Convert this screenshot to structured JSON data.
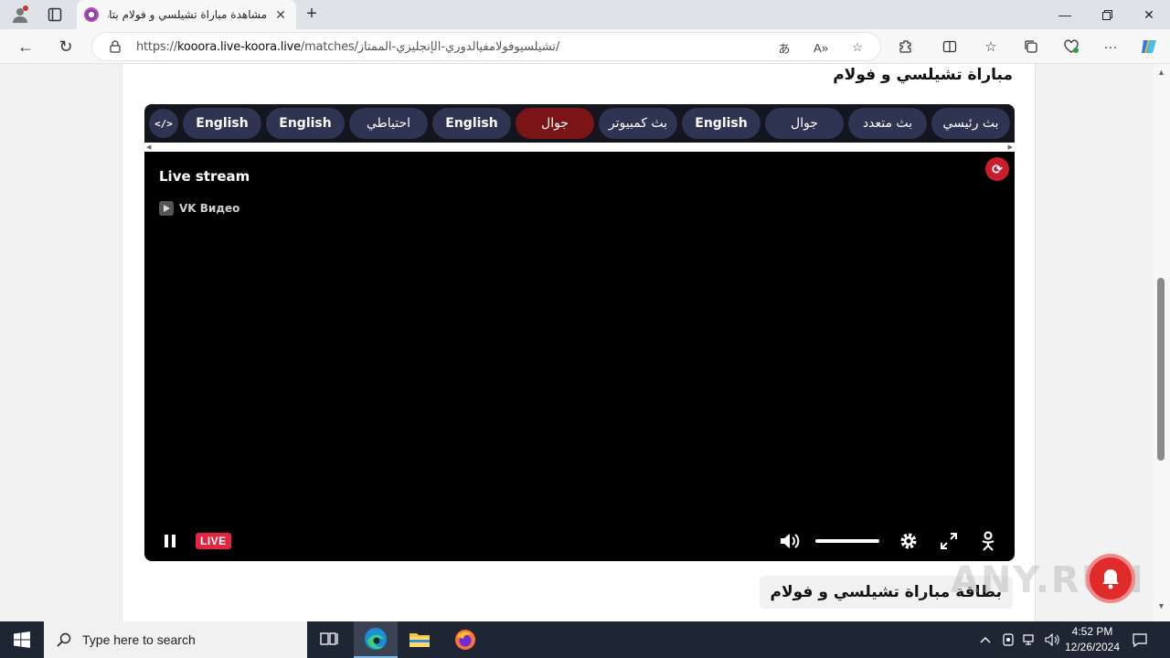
{
  "browser": {
    "tab_title": "مشاهدة مباراة تشيلسي و فولام بتاريخ",
    "url_domain": "kooora.live-koora.live",
    "url_prefix": "https://",
    "url_path": "/matches/تشيلسيوفولامفيالدوري-الإنجليزي-الممتاز/",
    "icons": [
      "profile-icon",
      "tab-actions-icon",
      "new-tab-icon",
      "back-icon",
      "refresh-icon",
      "lock-icon",
      "translate-icon",
      "read-aloud-icon",
      "favorite-icon",
      "extensions-icon",
      "split-screen-icon",
      "favorites-icon",
      "collections-icon",
      "browser-essentials-icon",
      "more-icon",
      "copilot-icon"
    ]
  },
  "page": {
    "title": "مباراة تشيلسي و فولام",
    "servers": [
      {
        "label": "بث رئيسي",
        "active": false
      },
      {
        "label": "بث متعدد",
        "active": false
      },
      {
        "label": "جوال",
        "active": false
      },
      {
        "label": "English",
        "active": false
      },
      {
        "label": "بث كمبيوتر",
        "active": false
      },
      {
        "label": "جوال",
        "active": true
      },
      {
        "label": "English",
        "active": false
      },
      {
        "label": "احتياطي",
        "active": false
      },
      {
        "label": "English",
        "active": false
      },
      {
        "label": "English",
        "active": false
      }
    ],
    "embed_label": "</>",
    "player": {
      "heading": "Live stream",
      "provider": "VK Видео",
      "live_label": "LIVE",
      "volume": 1.0
    },
    "card_title": "بطاقة مباراة تشيلسي و فولام",
    "watermark": "ANY.RUN"
  },
  "taskbar": {
    "search_placeholder": "Type here to search",
    "time": "4:52 PM",
    "date": "12/26/2024"
  },
  "colors": {
    "server_button": "#2e3451",
    "server_active": "#7b1416",
    "live_badge": "#e3263f",
    "taskbar": "#1f2633"
  }
}
